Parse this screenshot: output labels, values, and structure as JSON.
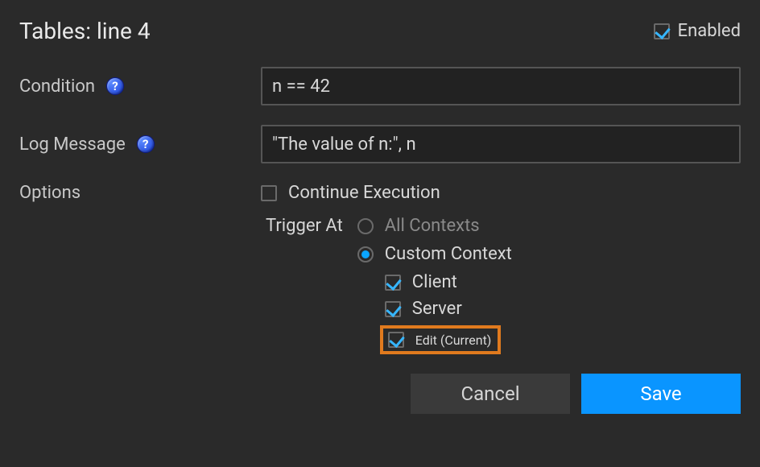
{
  "title": "Tables: line 4",
  "enabled": {
    "label": "Enabled",
    "checked": true
  },
  "condition": {
    "label": "Condition",
    "value": "n == 42"
  },
  "log_message": {
    "label": "Log Message",
    "value": "\"The value of n:\", n"
  },
  "options": {
    "label": "Options",
    "continue_execution": {
      "label": "Continue Execution",
      "checked": false
    },
    "trigger_at": {
      "label": "Trigger At",
      "all_contexts": {
        "label": "All Contexts",
        "selected": false
      },
      "custom_context": {
        "label": "Custom Context",
        "selected": true,
        "contexts": {
          "client": {
            "label": "Client",
            "checked": true
          },
          "server": {
            "label": "Server",
            "checked": true
          },
          "edit": {
            "label": "Edit (Current)",
            "checked": true,
            "highlighted": true
          }
        }
      }
    }
  },
  "buttons": {
    "cancel": "Cancel",
    "save": "Save"
  },
  "colors": {
    "accent": "#0a95ff",
    "highlight": "#e07a1e"
  }
}
